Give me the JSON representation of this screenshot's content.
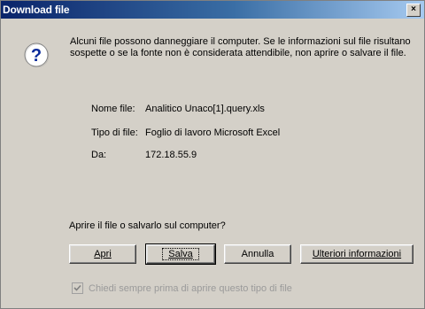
{
  "window": {
    "title": "Download file",
    "close_symbol": "×"
  },
  "message": {
    "icon": "question-icon",
    "text": "Alcuni file possono danneggiare il computer. Se le informazioni sul file risultano sospette o se la fonte non è considerata attendibile, non aprire o salvare il file."
  },
  "fields": [
    {
      "label": "Nome file:",
      "value": "Analitico Unaco[1].query.xls"
    },
    {
      "label": "Tipo di file:",
      "value": "Foglio di lavoro Microsoft Excel"
    },
    {
      "label": "Da:",
      "value": "172.18.55.9"
    }
  ],
  "question": "Aprire il file o salvarlo sul computer?",
  "buttons": {
    "open": "Apri",
    "save": "Salva",
    "cancel": "Annulla",
    "more_info": "Ulteriori informazioni"
  },
  "checkbox": {
    "checked": true,
    "label": "Chiedi sempre prima di aprire questo tipo di file"
  },
  "colors": {
    "title_start": "#0a246a",
    "title_end": "#a6caf0",
    "face": "#d4d0c8"
  }
}
